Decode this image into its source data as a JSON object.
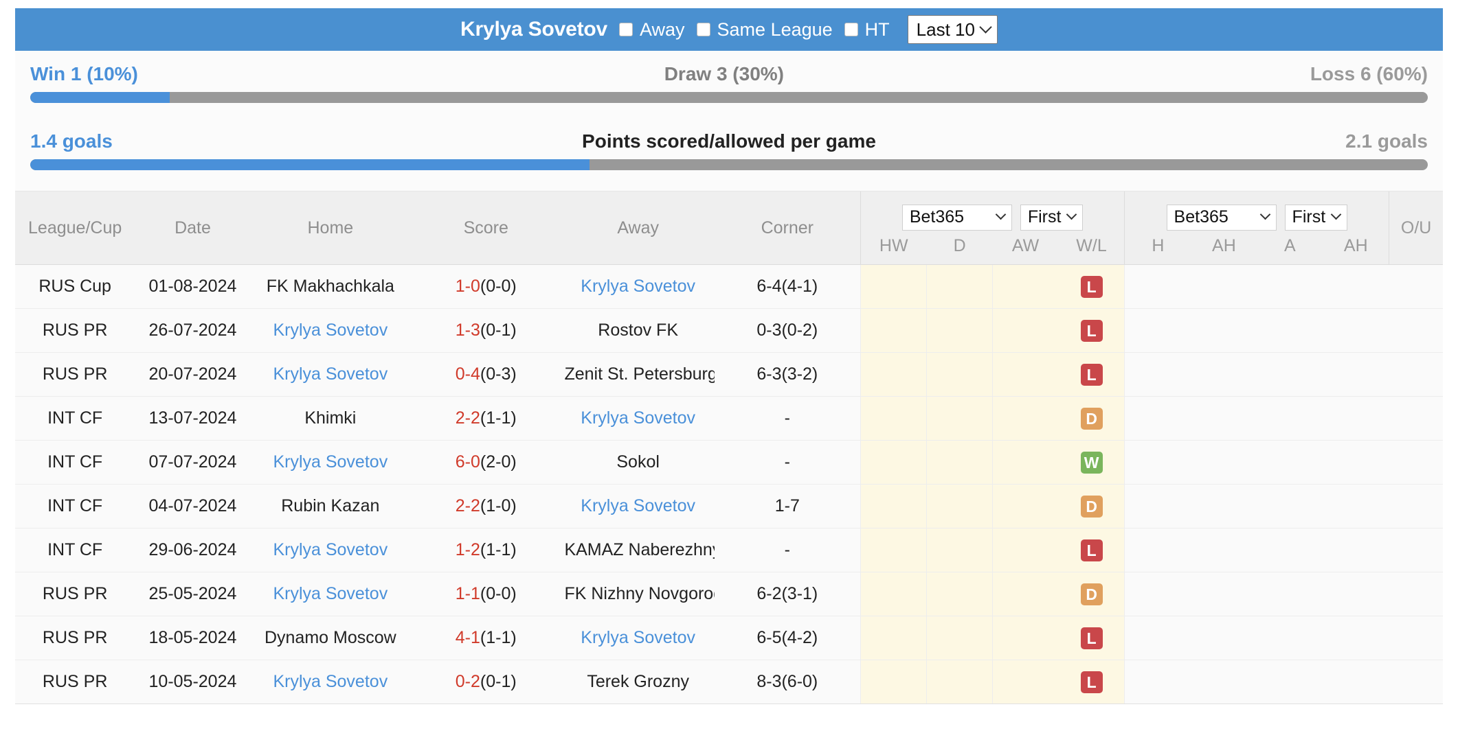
{
  "header": {
    "team_title": "Krylya Sovetov",
    "checkboxes": [
      {
        "label": "Away",
        "checked": false
      },
      {
        "label": "Same League",
        "checked": false
      },
      {
        "label": "HT",
        "checked": false
      }
    ],
    "range_select": {
      "value": "Last 10",
      "icon": "chevron-down-icon"
    }
  },
  "stats": {
    "record": {
      "left_label": "Win 1 (10%)",
      "mid_label": "Draw 3 (30%)",
      "right_label": "Loss 6 (60%)",
      "fill_percent": 10,
      "fill_color": "#4a90d9",
      "track_color": "#999999"
    },
    "goals": {
      "left_label": "1.4 goals",
      "mid_label": "Points scored/allowed per game",
      "right_label": "2.1 goals",
      "fill_percent": 40,
      "fill_color": "#4a90d9",
      "track_color": "#999999"
    }
  },
  "table": {
    "columns": [
      "League/Cup",
      "Date",
      "Home",
      "Score",
      "Away",
      "Corner"
    ],
    "odds_group_1": {
      "bookmaker_select": "Bet365",
      "period_select": "First",
      "sub_columns": [
        "HW",
        "D",
        "AW",
        "W/L"
      ]
    },
    "odds_group_2": {
      "bookmaker_select": "Bet365",
      "period_select": "First",
      "sub_columns": [
        "H",
        "AH",
        "A",
        "AH"
      ]
    },
    "ou_column": "O/U",
    "rows": [
      {
        "league": "RUS Cup",
        "date": "01-08-2024",
        "home": "FK Makhachkala",
        "home_is_team": false,
        "score_main": "1-0",
        "score_ht": "(0-0)",
        "away": "Krylya Sovetov",
        "away_is_team": true,
        "corner": "6-4(4-1)",
        "result": "L"
      },
      {
        "league": "RUS PR",
        "date": "26-07-2024",
        "home": "Krylya Sovetov",
        "home_is_team": true,
        "score_main": "1-3",
        "score_ht": "(0-1)",
        "away": "Rostov FK",
        "away_is_team": false,
        "corner": "0-3(0-2)",
        "result": "L"
      },
      {
        "league": "RUS PR",
        "date": "20-07-2024",
        "home": "Krylya Sovetov",
        "home_is_team": true,
        "score_main": "0-4",
        "score_ht": "(0-3)",
        "away": "Zenit St. Petersburg",
        "away_is_team": false,
        "corner": "6-3(3-2)",
        "result": "L"
      },
      {
        "league": "INT CF",
        "date": "13-07-2024",
        "home": "Khimki",
        "home_is_team": false,
        "score_main": "2-2",
        "score_ht": "(1-1)",
        "away": "Krylya Sovetov",
        "away_is_team": true,
        "corner": "-",
        "result": "D"
      },
      {
        "league": "INT CF",
        "date": "07-07-2024",
        "home": "Krylya Sovetov",
        "home_is_team": true,
        "score_main": "6-0",
        "score_ht": "(2-0)",
        "away": "Sokol",
        "away_is_team": false,
        "corner": "-",
        "result": "W"
      },
      {
        "league": "INT CF",
        "date": "04-07-2024",
        "home": "Rubin Kazan",
        "home_is_team": false,
        "score_main": "2-2",
        "score_ht": "(1-0)",
        "away": "Krylya Sovetov",
        "away_is_team": true,
        "corner": "1-7",
        "result": "D"
      },
      {
        "league": "INT CF",
        "date": "29-06-2024",
        "home": "Krylya Sovetov",
        "home_is_team": true,
        "score_main": "1-2",
        "score_ht": "(1-1)",
        "away": "KAMAZ Naberezhnye Chelny",
        "away_is_team": false,
        "corner": "-",
        "result": "L"
      },
      {
        "league": "RUS PR",
        "date": "25-05-2024",
        "home": "Krylya Sovetov",
        "home_is_team": true,
        "score_main": "1-1",
        "score_ht": "(0-0)",
        "away": "FK Nizhny Novgorod",
        "away_is_team": false,
        "corner": "6-2(3-1)",
        "result": "D"
      },
      {
        "league": "RUS PR",
        "date": "18-05-2024",
        "home": "Dynamo Moscow",
        "home_is_team": false,
        "score_main": "4-1",
        "score_ht": "(1-1)",
        "away": "Krylya Sovetov",
        "away_is_team": true,
        "corner": "6-5(4-2)",
        "result": "L"
      },
      {
        "league": "RUS PR",
        "date": "10-05-2024",
        "home": "Krylya Sovetov",
        "home_is_team": true,
        "score_main": "0-2",
        "score_ht": "(0-1)",
        "away": "Terek Grozny",
        "away_is_team": false,
        "corner": "8-3(6-0)",
        "result": "L"
      }
    ]
  },
  "colors": {
    "header_blue": "#4a90d0",
    "link_blue": "#4a90d9",
    "score_red": "#d03a2a",
    "badge_loss": "#c9474a",
    "badge_draw": "#e0a05e",
    "badge_win": "#7ab55c",
    "odds_band": "#fdf8e3"
  }
}
